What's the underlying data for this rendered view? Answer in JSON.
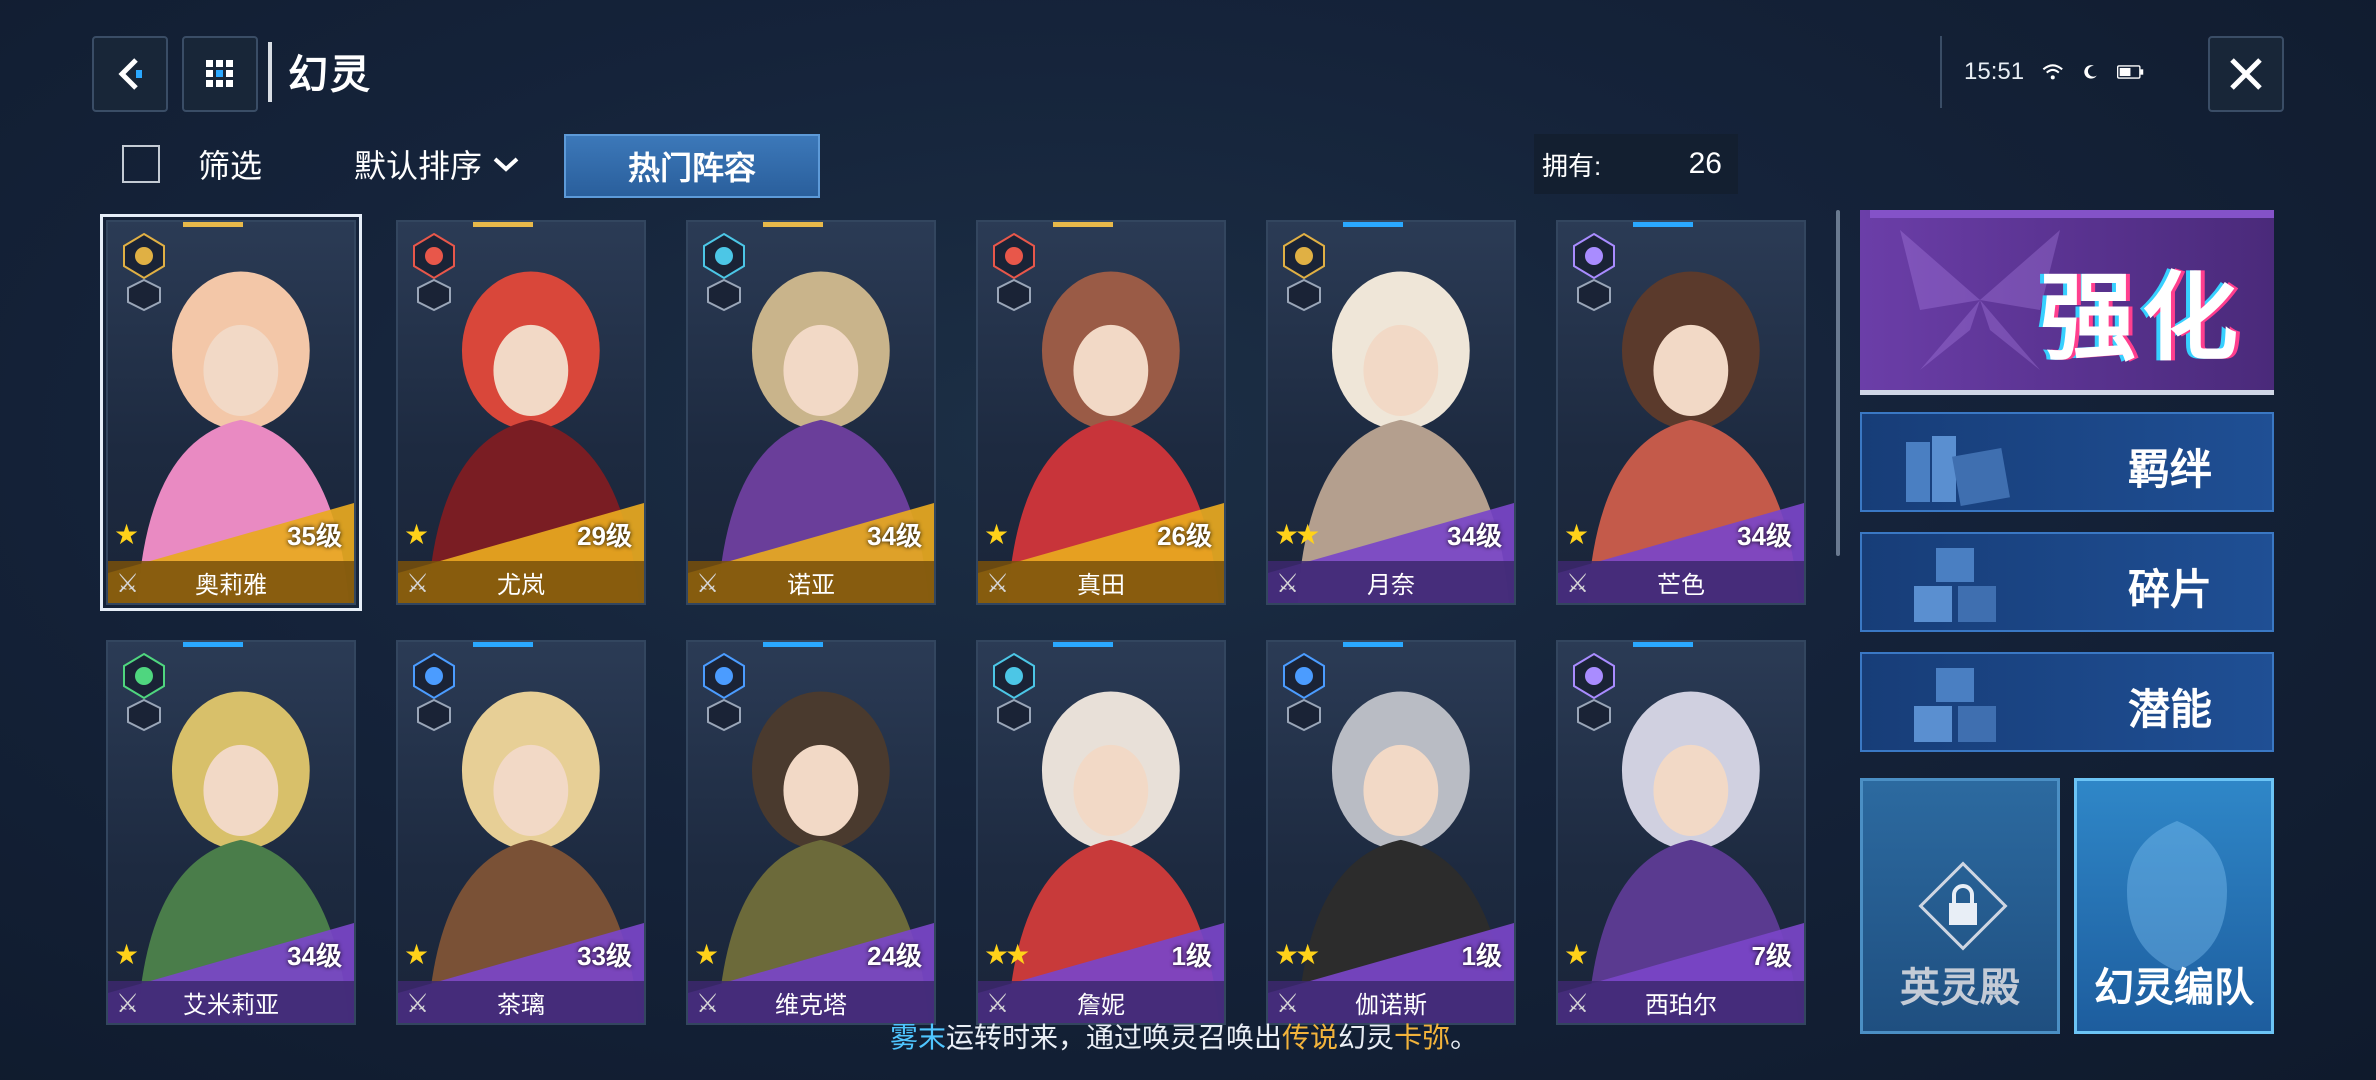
{
  "header": {
    "title": "幻灵",
    "time": "15:51"
  },
  "toolbar": {
    "filter_label": "筛选",
    "sort_label": "默认排序",
    "hot_label": "热门阵容",
    "owned_label": "拥有:",
    "owned_count": "26"
  },
  "cards": [
    {
      "name": "奥莉雅",
      "level": "35级",
      "stars": 1,
      "rarity": "gold",
      "element": "light"
    },
    {
      "name": "尤岚",
      "level": "29级",
      "stars": 1,
      "rarity": "gold",
      "element": "fire"
    },
    {
      "name": "诺亚",
      "level": "34级",
      "stars": 0,
      "rarity": "gold",
      "element": "water"
    },
    {
      "name": "真田",
      "level": "26级",
      "stars": 1,
      "rarity": "gold",
      "element": "fire"
    },
    {
      "name": "月奈",
      "level": "34级",
      "stars": 2,
      "rarity": "purple",
      "element": "light"
    },
    {
      "name": "芒色",
      "level": "34级",
      "stars": 1,
      "rarity": "purple",
      "element": "dark"
    },
    {
      "name": "艾米莉亚",
      "level": "34级",
      "stars": 1,
      "rarity": "purple",
      "element": "wind"
    },
    {
      "name": "茶璃",
      "level": "33级",
      "stars": 1,
      "rarity": "purple",
      "element": "thunder"
    },
    {
      "name": "维克塔",
      "level": "24级",
      "stars": 1,
      "rarity": "purple",
      "element": "thunder"
    },
    {
      "name": "詹妮",
      "level": "1级",
      "stars": 2,
      "rarity": "purple",
      "element": "water"
    },
    {
      "name": "伽诺斯",
      "level": "1级",
      "stars": 2,
      "rarity": "purple",
      "element": "thunder"
    },
    {
      "name": "西珀尔",
      "level": "7级",
      "stars": 1,
      "rarity": "purple",
      "element": "dark"
    }
  ],
  "menu": {
    "enhance": "强化",
    "bond": "羁绊",
    "fragment": "碎片",
    "potential": "潜能",
    "hall": "英灵殿",
    "team": "幻灵编队"
  },
  "ticker": {
    "part1": "雾末",
    "part2": "运转时来，通过唤灵召唤出",
    "part3": "传说",
    "part4": "幻灵",
    "part5": "卡弥",
    "part6": "。"
  },
  "colors": {
    "accent_blue": "#2a5f9c",
    "gold": "#e8b94a",
    "purple": "#6b3ea8",
    "star": "#ffd21a"
  }
}
